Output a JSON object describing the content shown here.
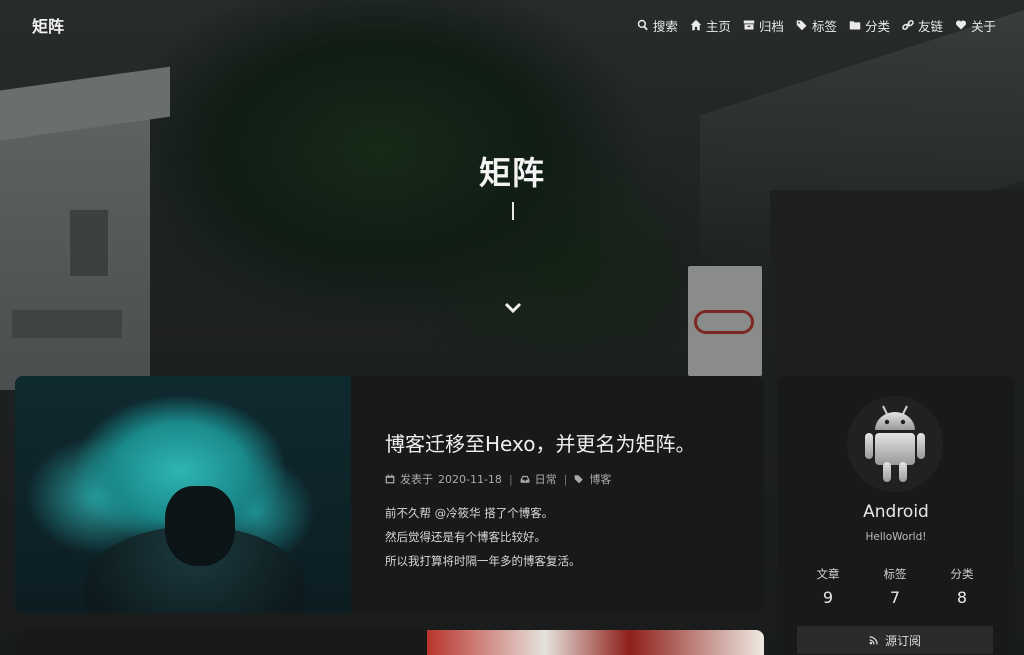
{
  "site": {
    "brand": "矩阵",
    "hero_title": "矩阵"
  },
  "nav": {
    "items": [
      {
        "label": "搜索",
        "icon": "search-icon"
      },
      {
        "label": "主页",
        "icon": "home-icon"
      },
      {
        "label": "归档",
        "icon": "archive-icon"
      },
      {
        "label": "标签",
        "icon": "tags-icon"
      },
      {
        "label": "分类",
        "icon": "folder-icon"
      },
      {
        "label": "友链",
        "icon": "link-icon"
      },
      {
        "label": "关于",
        "icon": "heart-icon"
      }
    ]
  },
  "post": {
    "title": "博客迁移至Hexo，并更名为矩阵。",
    "meta": {
      "posted_prefix": "发表于",
      "date": "2020-11-18",
      "category": "日常",
      "tag": "博客"
    },
    "excerpt": [
      "前不久帮 @冷筱华 搭了个博客。",
      "然后觉得还是有个博客比较好。",
      "所以我打算将时隔一年多的博客复活。"
    ]
  },
  "author": {
    "name": "Android",
    "description": "HelloWorld!",
    "stats": [
      {
        "label": "文章",
        "value": "9"
      },
      {
        "label": "标签",
        "value": "7"
      },
      {
        "label": "分类",
        "value": "8"
      }
    ],
    "rss_label": "源订阅"
  },
  "colors": {
    "card_bg": "#181919",
    "text": "#e6e6e6",
    "android_green_grey": "#cfcfcf"
  }
}
